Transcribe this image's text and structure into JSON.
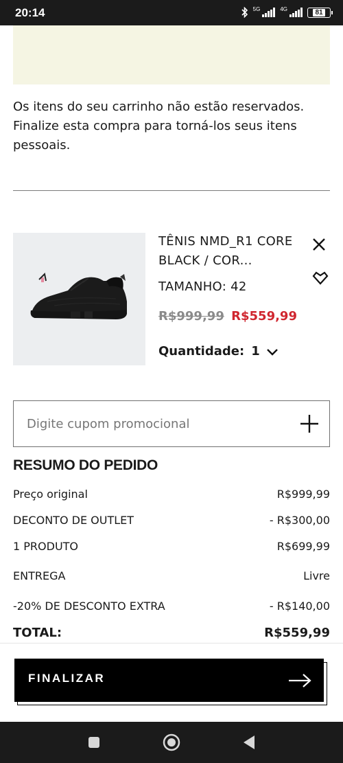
{
  "status_bar": {
    "time": "20:14",
    "network_1": "5G",
    "network_2": "4G",
    "battery": "81"
  },
  "cart": {
    "reservation_notice": "Os itens do seu carrinho não estão reservados. Finalize esta compra para torná-los seus itens pessoais."
  },
  "product": {
    "title": "TÊNIS NMD_R1 CORE BLACK / COR...",
    "size": "TAMANHO: 42",
    "price_original": "R$999,99",
    "price_sale": "R$559,99",
    "quantity_label": "Quantidade:",
    "quantity_value": "1"
  },
  "coupon": {
    "placeholder": "Digite cupom promocional"
  },
  "summary": {
    "title": "RESUMO DO PEDIDO",
    "rows": [
      {
        "label": "Preço original",
        "value": "R$999,99"
      },
      {
        "label": "DECONTO DE OUTLET",
        "value": "- R$300,00"
      },
      {
        "label": "1 PRODUTO",
        "value": "R$699,99"
      },
      {
        "label": "ENTREGA",
        "value": "Livre"
      },
      {
        "label": "-20% DE DESCONTO EXTRA",
        "value": "- R$140,00"
      }
    ],
    "total_label": "TOTAL:",
    "total_value": "R$559,99"
  },
  "checkout": {
    "label": "FINALIZAR"
  },
  "colors": {
    "accent_sale": "#d0262f",
    "notice_background": "#f5f5e3",
    "button": "#000000"
  },
  "icons": [
    "bluetooth-icon",
    "signal-icon",
    "battery-icon",
    "close-icon",
    "heart-icon",
    "chevron-down-icon",
    "plus-icon",
    "arrow-right-icon",
    "recent-apps-icon",
    "home-icon",
    "back-icon"
  ]
}
